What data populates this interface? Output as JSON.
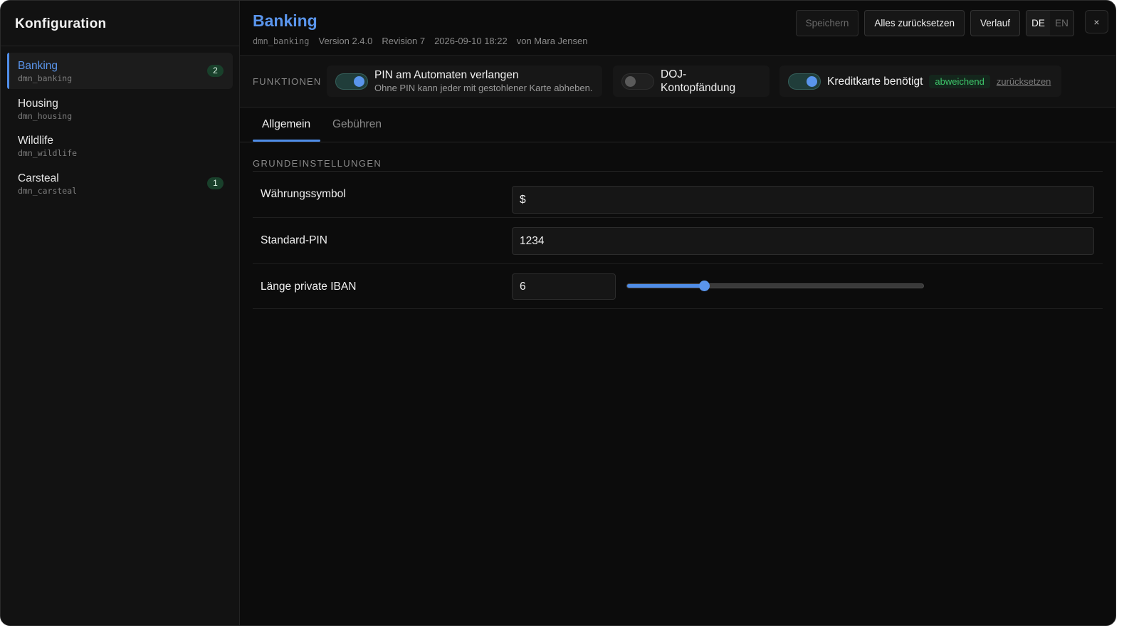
{
  "sidebar": {
    "title": "Konfiguration",
    "items": [
      {
        "label": "Banking",
        "key": "dmn_banking",
        "badge": "2",
        "active": true
      },
      {
        "label": "Housing",
        "key": "dmn_housing",
        "badge": null,
        "active": false
      },
      {
        "label": "Wildlife",
        "key": "dmn_wildlife",
        "badge": null,
        "active": false
      },
      {
        "label": "Carsteal",
        "key": "dmn_carsteal",
        "badge": "1",
        "active": false
      }
    ]
  },
  "header": {
    "title": "Banking",
    "key": "dmn_banking",
    "version": "Version 2.4.0",
    "revision": "Revision 7",
    "timestamp": "2026-09-10 18:22",
    "author": "von Mara Jensen",
    "buttons": {
      "save": "Speichern",
      "reset_all": "Alles zurücksetzen",
      "history": "Verlauf"
    },
    "languages": [
      "DE",
      "EN"
    ],
    "active_language": "DE",
    "close": "×"
  },
  "features": {
    "label": "FUNKTIONEN",
    "items": [
      {
        "name": "PIN am Automaten verlangen",
        "description": "Ohne PIN kann jeder mit gestohlener Karte abheben.",
        "enabled": true
      },
      {
        "name": "DOJ-Kontopfändung",
        "enabled": false
      },
      {
        "name": "Kreditkarte benötigt",
        "enabled": true,
        "status": "abweichend",
        "reset_label": "zurücksetzen"
      }
    ]
  },
  "tabs": [
    {
      "label": "Allgemein",
      "active": true
    },
    {
      "label": "Gebühren",
      "active": false
    }
  ],
  "section": {
    "title": "GRUNDEINSTELLUNGEN",
    "fields": {
      "currency": {
        "label": "Währungssymbol",
        "value": "$"
      },
      "pin": {
        "label": "Standard-PIN",
        "value": "1234"
      },
      "iban": {
        "label": "Länge private IBAN",
        "value": "6",
        "slider_fraction": 0.26
      }
    }
  },
  "colors": {
    "accent": "#4f8de8",
    "status_ok": "#3ec66a",
    "background": "#0c0c0c"
  }
}
